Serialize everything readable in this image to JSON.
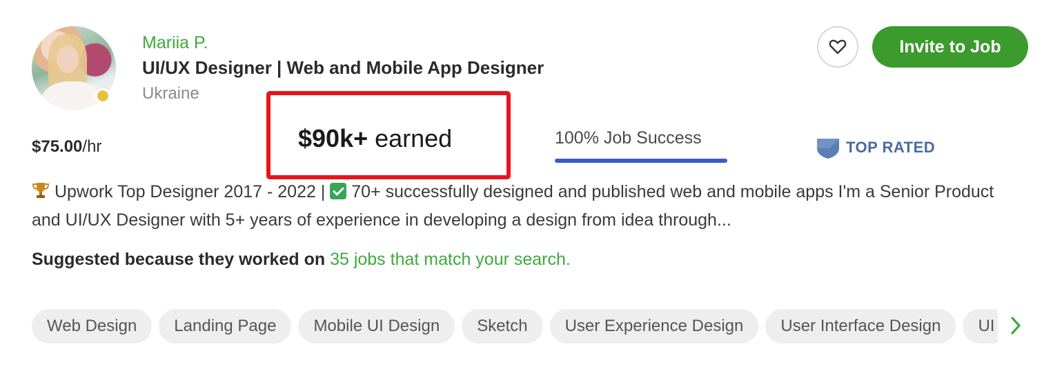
{
  "freelancer": {
    "name": "Mariia P.",
    "headline": "UI/UX Designer | Web and Mobile App Designer",
    "location": "Ukraine",
    "status_color": "#e6c23a"
  },
  "actions": {
    "favorite_icon": "heart-outline-icon",
    "invite_label": "Invite to Job",
    "invite_color": "#3b9b2c"
  },
  "stats": {
    "rate_amount": "$75.00",
    "rate_unit": "/hr",
    "earned_amount": "$90k+",
    "earned_label": " earned",
    "job_success": "100% Job Success",
    "job_success_percent": 100,
    "badge_label": "TOP RATED",
    "badge_color": "#4a6aa0",
    "highlight_color": "#e8141d"
  },
  "bio": {
    "part1": " Upwork Top Designer 2017 - 2022 | ",
    "part2": " 70+ successfully designed and published web and mobile apps I'm a Senior Product and UI/UX Designer with 5+ years of experience in developing a design from idea through..."
  },
  "suggestion": {
    "prefix": "Suggested because they worked on ",
    "link": "35 jobs that match your search."
  },
  "skills": [
    "Web Design",
    "Landing Page",
    "Mobile UI Design",
    "Sketch",
    "User Experience Design",
    "User Interface Design",
    "UI"
  ]
}
